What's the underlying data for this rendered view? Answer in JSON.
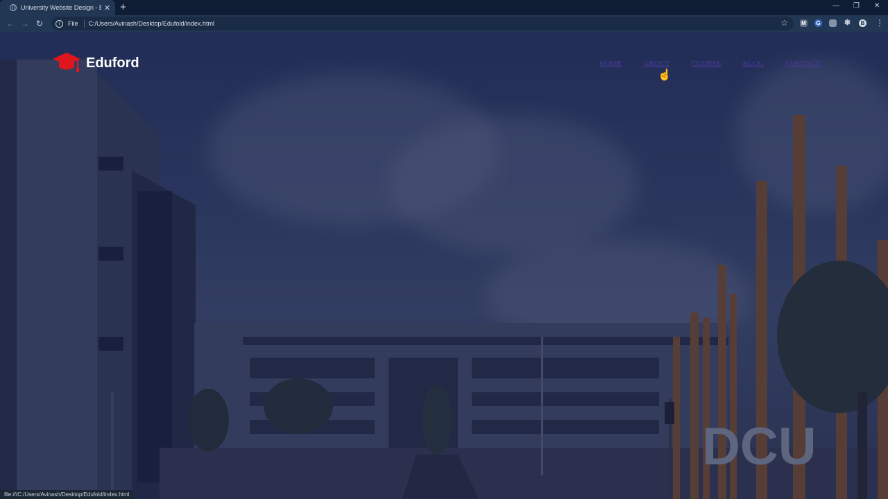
{
  "browser": {
    "tab_title": "University Website Design - Eas",
    "tab_close": "✕",
    "new_tab": "+",
    "omnibox_scheme": "File",
    "url": "C:/Users/Avinash/Desktop/Edufold/index.html",
    "status_url": "file:///C:/Users/Avinash/Desktop/Edufold/index.html",
    "extensions": [
      "M",
      "G",
      "",
      "",
      "B"
    ]
  },
  "site": {
    "logo_text": "Eduford",
    "logo_color": "#e0161f",
    "nav": [
      "HOME",
      "ABOUT",
      "COURSE",
      "BLOG",
      "CONTACT"
    ],
    "nav_color": "#4a3b9e",
    "sign_text": "DCU"
  }
}
